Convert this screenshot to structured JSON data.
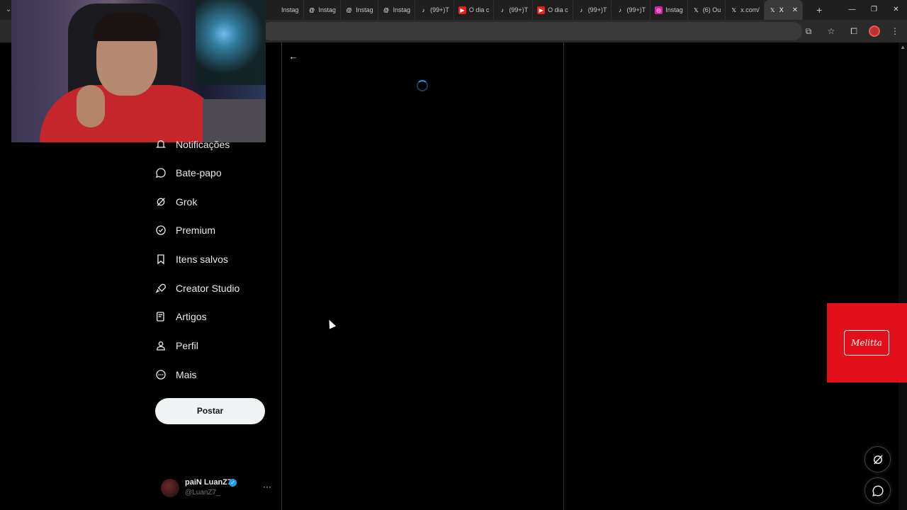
{
  "browser": {
    "tabs": [
      {
        "label": "Instag",
        "icon": "none"
      },
      {
        "label": "Instag",
        "icon": "threads"
      },
      {
        "label": "Instag",
        "icon": "threads"
      },
      {
        "label": "Instag",
        "icon": "threads"
      },
      {
        "label": "(99+)T",
        "icon": "tiktok"
      },
      {
        "label": "O dia c",
        "icon": "youtube"
      },
      {
        "label": "(99+)T",
        "icon": "tiktok"
      },
      {
        "label": "O dia c",
        "icon": "youtube"
      },
      {
        "label": "(99+)T",
        "icon": "tiktok"
      },
      {
        "label": "(99+)T",
        "icon": "tiktok"
      },
      {
        "label": "Instag",
        "icon": "instagram"
      },
      {
        "label": "(6) Ou",
        "icon": "x"
      },
      {
        "label": "x.com/",
        "icon": "x"
      },
      {
        "label": "X",
        "icon": "x",
        "active": true
      }
    ],
    "new_tab": "+",
    "window_controls": {
      "minimize": "—",
      "restore": "❐",
      "close": "✕"
    }
  },
  "nav": {
    "items": [
      {
        "label": "Notificações",
        "icon": "bell-icon"
      },
      {
        "label": "Bate-papo",
        "icon": "chat-icon"
      },
      {
        "label": "Grok",
        "icon": "grok-icon"
      },
      {
        "label": "Premium",
        "icon": "premium-icon"
      },
      {
        "label": "Itens salvos",
        "icon": "bookmark-icon"
      },
      {
        "label": "Creator Studio",
        "icon": "rocket-icon"
      },
      {
        "label": "Artigos",
        "icon": "articles-icon"
      },
      {
        "label": "Perfil",
        "icon": "person-icon"
      },
      {
        "label": "Mais",
        "icon": "more-circle-icon"
      }
    ],
    "post_label": "Postar"
  },
  "user": {
    "name": "paiN LuanZ7",
    "handle": "@LuanZ7_",
    "more": "···"
  },
  "main": {
    "back": "←"
  },
  "ad": {
    "brand": "Melitta",
    "color": "#e3101b"
  },
  "colors": {
    "background": "#000000",
    "accent": "#1d9bf0",
    "text": "#e7e9ea",
    "muted": "#71767b"
  }
}
